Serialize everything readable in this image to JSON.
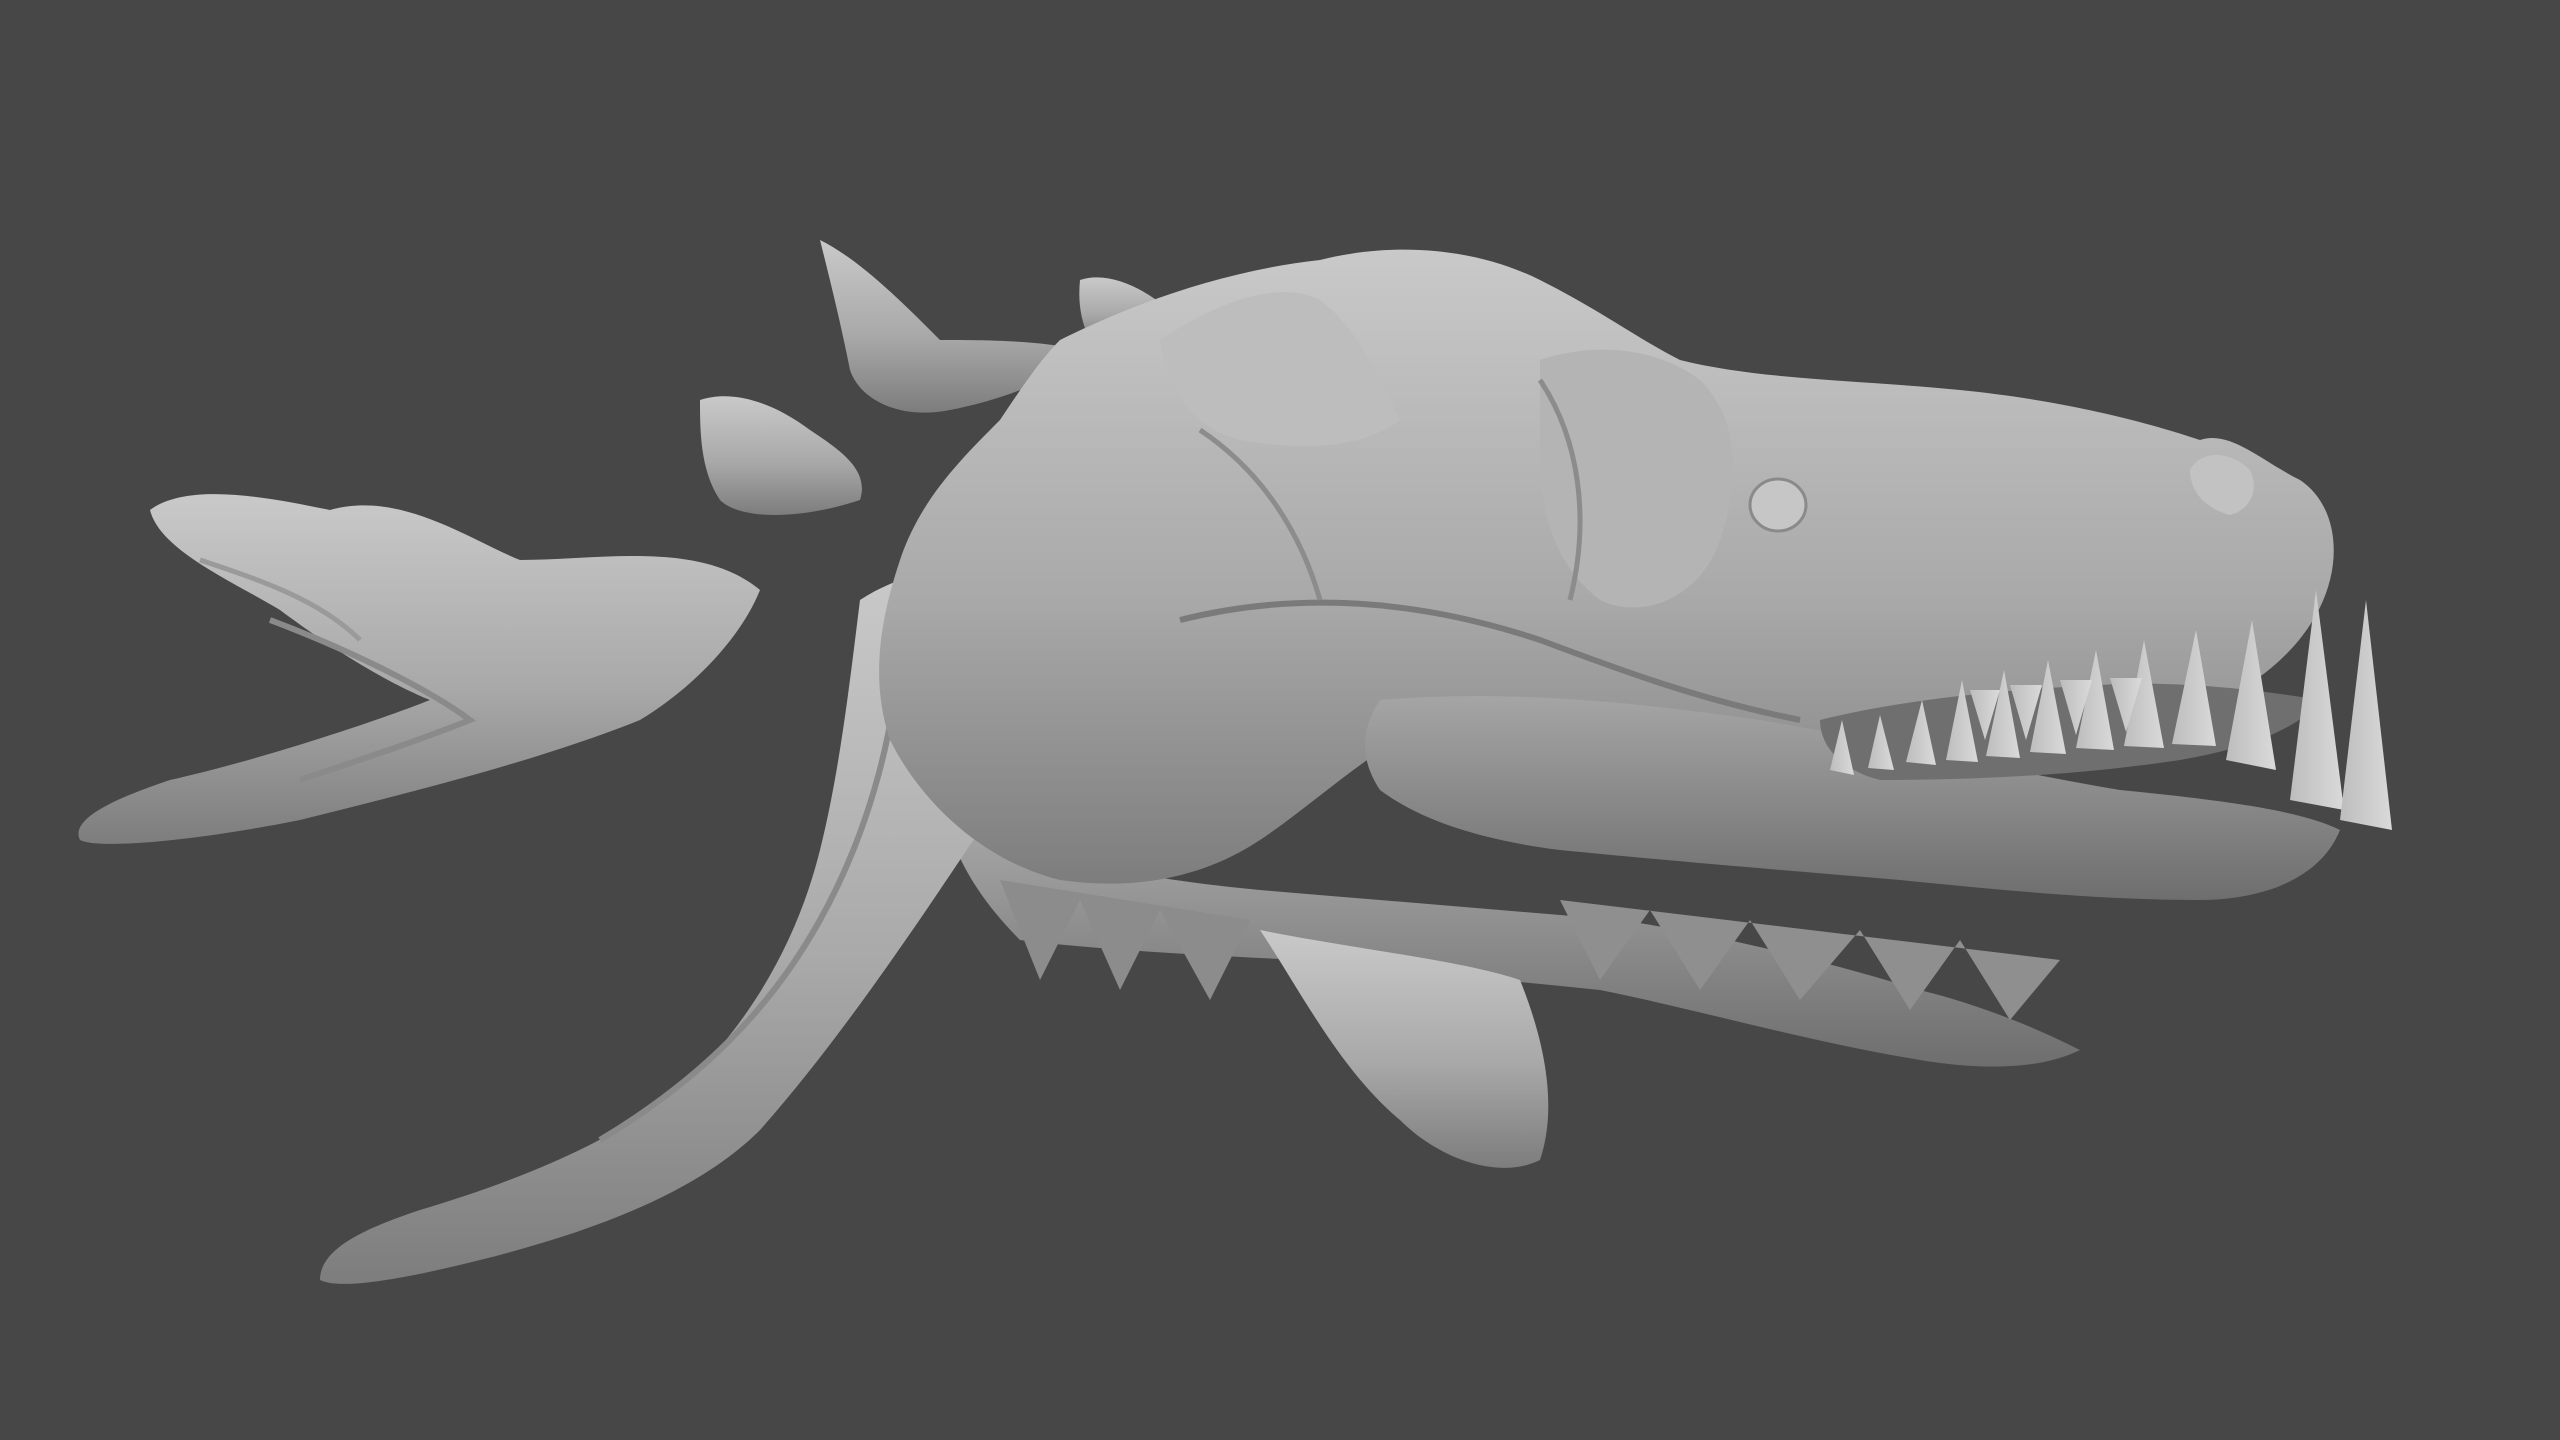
{
  "viewport": {
    "background_color": "#474747",
    "mesh_base_color": "#a8a8a8",
    "mesh_highlight_color": "#cfcfcf",
    "mesh_shadow_color": "#5f5f5f",
    "object": "dragon-skull-sculpt"
  }
}
